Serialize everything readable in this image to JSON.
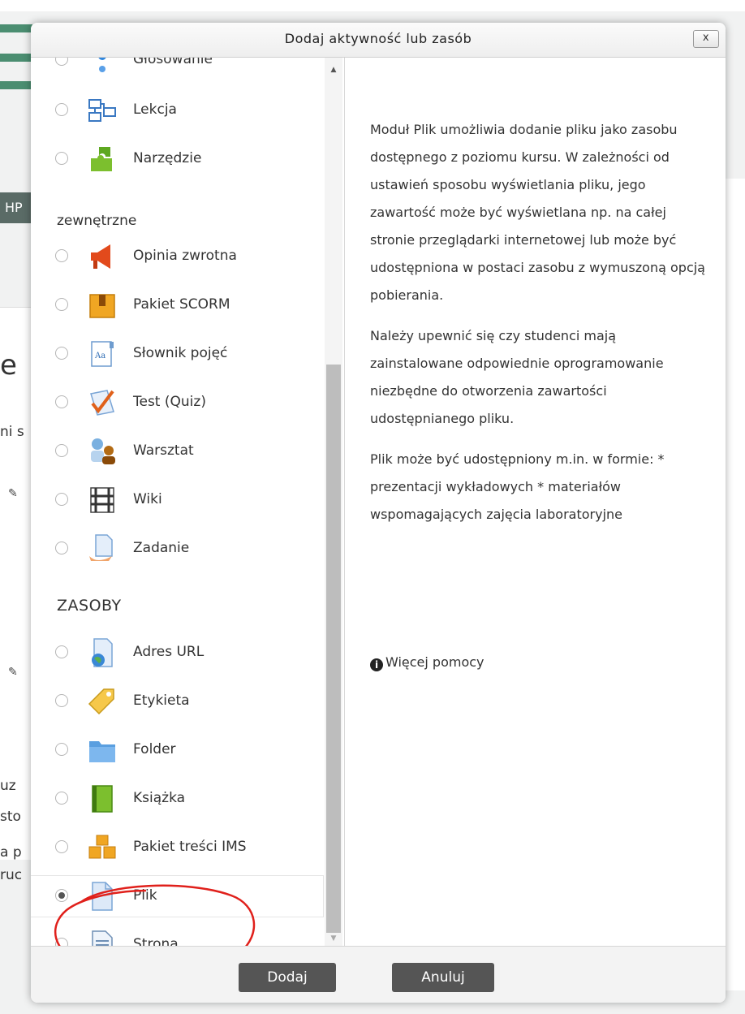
{
  "dialog": {
    "title": "Dodaj aktywność lub zasób",
    "close_label": "x"
  },
  "background": {
    "hp_label": "HP",
    "heading_fragment": "e",
    "line1": "ni s",
    "line2": "uz",
    "line3": "sto",
    "line4": "a p",
    "line5": "ruc"
  },
  "options": {
    "glosowanie": "Głosowanie",
    "lekcja": "Lekcja",
    "narzedzie_1": "Narzędzie",
    "narzedzie_2": "zewnętrzne",
    "opinia": "Opinia zwrotna",
    "scorm": "Pakiet SCORM",
    "slownik": "Słownik pojęć",
    "test": "Test (Quiz)",
    "warsztat": "Warsztat",
    "wiki": "Wiki",
    "zadanie": "Zadanie",
    "resources_title": "ZASOBY",
    "url": "Adres URL",
    "etykieta": "Etykieta",
    "folder": "Folder",
    "ksiazka": "Książka",
    "ims": "Pakiet treści IMS",
    "plik": "Plik",
    "strona": "Strona"
  },
  "help": {
    "p1": "Moduł Plik umożliwia dodanie pliku jako zasobu dostępnego z poziomu kursu. W zależności od ustawień sposobu wyświetlania pliku, jego zawartość może być wyświetlana np. na całej stronie przeglądarki internetowej lub może być udostępniona w postaci zasobu z wymuszoną opcją pobierania.",
    "p2": "Należy upewnić się czy studenci mają zainstalowane odpowiednie oprogramowanie niezbędne do otworzenia zawartości udostępnianego pliku.",
    "p3": "Plik może być udostępniony m.in. w formie: * prezentacji wykładowych * materiałów wspomagających zajęcia laboratoryjne",
    "more_link": "Więcej pomocy",
    "info_glyph": "i"
  },
  "footer": {
    "add_label": "Dodaj",
    "cancel_label": "Anuluj"
  },
  "colors": {
    "button_bg": "#555555",
    "annotation": "#e0201b"
  }
}
